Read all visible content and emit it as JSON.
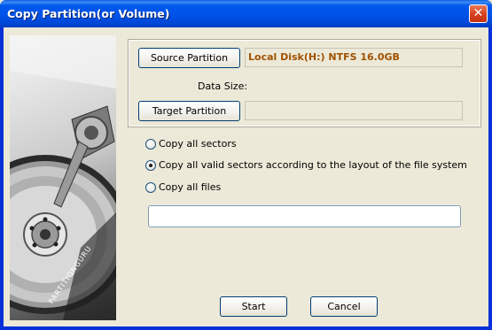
{
  "window": {
    "title": "Copy Partition(or Volume)",
    "close_icon": "close-icon",
    "close_glyph": "✕"
  },
  "banner": {
    "brand_text": "PARTITIONGURU"
  },
  "source": {
    "button_label": "Source Partition",
    "value": "Local Disk(H:) NTFS 16.0GB"
  },
  "data_size": {
    "label": "Data Size:",
    "value": ""
  },
  "target": {
    "button_label": "Target Partition",
    "value": ""
  },
  "copy_options": [
    {
      "label": "Copy all sectors",
      "selected": false
    },
    {
      "label": "Copy all valid sectors according to the layout of the file system",
      "selected": true
    },
    {
      "label": "Copy all files",
      "selected": false
    }
  ],
  "path_input": {
    "value": ""
  },
  "actions": {
    "start_label": "Start",
    "cancel_label": "Cancel"
  },
  "colors": {
    "title_bar": "#0054e3",
    "source_value": "#a05200",
    "close_button": "#d9421f"
  }
}
